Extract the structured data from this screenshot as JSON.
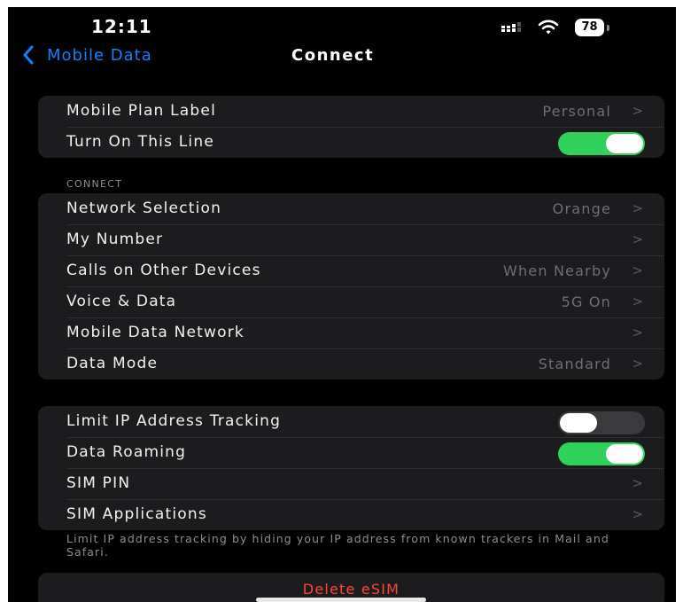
{
  "status_bar": {
    "time": "12:11",
    "battery": "78",
    "signal_icon": "cellular-signal-icon",
    "wifi_icon": "wifi-icon"
  },
  "nav": {
    "back_label": "Mobile Data",
    "back_icon": "chevron-left-icon",
    "title": "Connect"
  },
  "group_top": [
    {
      "label": "Mobile Plan Label",
      "value": "Personal",
      "type": "disclosure"
    },
    {
      "label": "Turn On This Line",
      "type": "toggle",
      "on": true
    }
  ],
  "connect_section": {
    "header": "CONNECT",
    "rows": [
      {
        "label": "Network Selection",
        "value": "Orange",
        "type": "disclosure"
      },
      {
        "label": "My Number",
        "value": "",
        "type": "disclosure"
      },
      {
        "label": "Calls on Other Devices",
        "value": "When Nearby",
        "type": "disclosure"
      },
      {
        "label": "Voice & Data",
        "value": "5G On",
        "type": "disclosure"
      },
      {
        "label": "Mobile Data Network",
        "value": "",
        "type": "disclosure"
      },
      {
        "label": "Data Mode",
        "value": "Standard",
        "type": "disclosure"
      }
    ]
  },
  "group_privacy": [
    {
      "label": "Limit IP Address Tracking",
      "type": "toggle",
      "on": false
    },
    {
      "label": "Data Roaming",
      "type": "toggle",
      "on": true
    },
    {
      "label": "SIM PIN",
      "value": "",
      "type": "disclosure"
    },
    {
      "label": "SIM Applications",
      "value": "",
      "type": "disclosure"
    }
  ],
  "footer_note": "Limit IP address tracking by hiding your IP address from known trackers in Mail and Safari.",
  "delete_label": "Delete eSIM",
  "chevron_glyph": ">",
  "colors": {
    "accent": "#0a84ff",
    "toggle_on": "#30d158",
    "destructive": "#ff453a",
    "cell_background": "#1c1c1e",
    "background": "#000000"
  }
}
